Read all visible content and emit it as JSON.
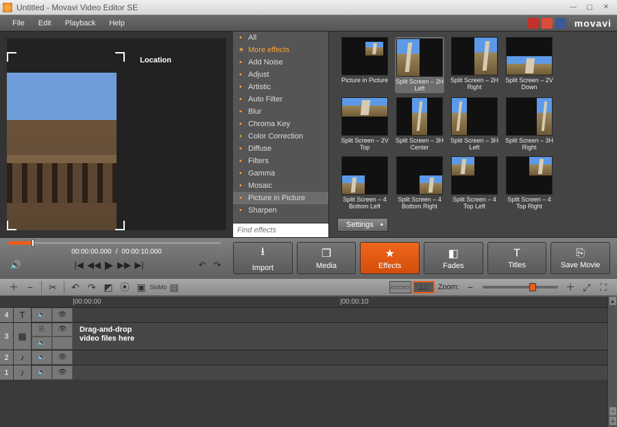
{
  "window": {
    "title": "Untitled - Movavi Video Editor SE",
    "brand": "movavi"
  },
  "menus": [
    "File",
    "Edit",
    "Playback",
    "Help"
  ],
  "preview": {
    "overlay_label": "Location"
  },
  "effect_categories": [
    {
      "label": "All",
      "star": false,
      "more": false,
      "selected": false
    },
    {
      "label": "More effects",
      "star": true,
      "more": true,
      "selected": false
    },
    {
      "label": "Add Noise",
      "star": false,
      "more": false,
      "selected": false
    },
    {
      "label": "Adjust",
      "star": false,
      "more": false,
      "selected": false
    },
    {
      "label": "Artistic",
      "star": false,
      "more": false,
      "selected": false
    },
    {
      "label": "Auto Filter",
      "star": false,
      "more": false,
      "selected": false
    },
    {
      "label": "Blur",
      "star": false,
      "more": false,
      "selected": false
    },
    {
      "label": "Chroma Key",
      "star": false,
      "more": false,
      "selected": false
    },
    {
      "label": "Color Correction",
      "star": false,
      "more": false,
      "selected": false
    },
    {
      "label": "Diffuse",
      "star": false,
      "more": false,
      "selected": false
    },
    {
      "label": "Filters",
      "star": false,
      "more": false,
      "selected": false
    },
    {
      "label": "Gamma",
      "star": false,
      "more": false,
      "selected": false
    },
    {
      "label": "Mosaic",
      "star": false,
      "more": false,
      "selected": false
    },
    {
      "label": "Picture in Picture",
      "star": false,
      "more": false,
      "selected": true
    },
    {
      "label": "Sharpen",
      "star": false,
      "more": false,
      "selected": false
    }
  ],
  "search_placeholder": "Find effects",
  "effects": [
    {
      "label": "Picture in Picture",
      "layout": "pip",
      "selected": false
    },
    {
      "label": "Split Screen – 2H Left",
      "layout": "2h-left",
      "selected": true
    },
    {
      "label": "Split Screen – 2H Right",
      "layout": "2h-right",
      "selected": false
    },
    {
      "label": "Split Screen – 2V Down",
      "layout": "2v-down",
      "selected": false
    },
    {
      "label": "Split Screen – 2V Top",
      "layout": "2v-top",
      "selected": false
    },
    {
      "label": "Split Screen – 3H Center",
      "layout": "3h-center",
      "selected": false
    },
    {
      "label": "Split Screen – 3H Left",
      "layout": "3h-left",
      "selected": false
    },
    {
      "label": "Split Screen – 3H Right",
      "layout": "3h-right",
      "selected": false
    },
    {
      "label": "Split Screen – 4 Bottom Left",
      "layout": "4-bl",
      "selected": false
    },
    {
      "label": "Split Screen – 4 Bottom Right",
      "layout": "4-br",
      "selected": false
    },
    {
      "label": "Split Screen – 4 Top Left",
      "layout": "4-tl",
      "selected": false
    },
    {
      "label": "Split Screen – 4 Top Right",
      "layout": "4-tr",
      "selected": false
    }
  ],
  "settings_label": "Settings",
  "transport": {
    "current": "00:00:00.000",
    "sep": "/",
    "total": "00:00:10.000"
  },
  "main_tabs": [
    {
      "id": "import",
      "label": "Import",
      "icon": "⭳"
    },
    {
      "id": "media",
      "label": "Media",
      "icon": "❐"
    },
    {
      "id": "effects",
      "label": "Effects",
      "icon": "★",
      "active": true
    },
    {
      "id": "fades",
      "label": "Fades",
      "icon": "◧"
    },
    {
      "id": "titles",
      "label": "Titles",
      "icon": "T"
    },
    {
      "id": "save",
      "label": "Save Movie",
      "icon": "⎘"
    }
  ],
  "zoom_label": "Zoom:",
  "ruler": {
    "t0": "|00:00:00",
    "t1": "|00:00:10"
  },
  "tracks": [
    {
      "num": "4",
      "type": "title",
      "icon": "T",
      "rows": 1,
      "height": "tr-h1"
    },
    {
      "num": "3",
      "type": "video",
      "icon": "▦",
      "rows": 2,
      "height": "tr-h2",
      "hint": "Drag-and-drop\nvideo files here"
    },
    {
      "num": "2",
      "type": "audio",
      "icon": "♪",
      "rows": 1,
      "height": "tr-h1"
    },
    {
      "num": "1",
      "type": "audio",
      "icon": "♪",
      "rows": 1,
      "height": "tr-h1"
    }
  ]
}
